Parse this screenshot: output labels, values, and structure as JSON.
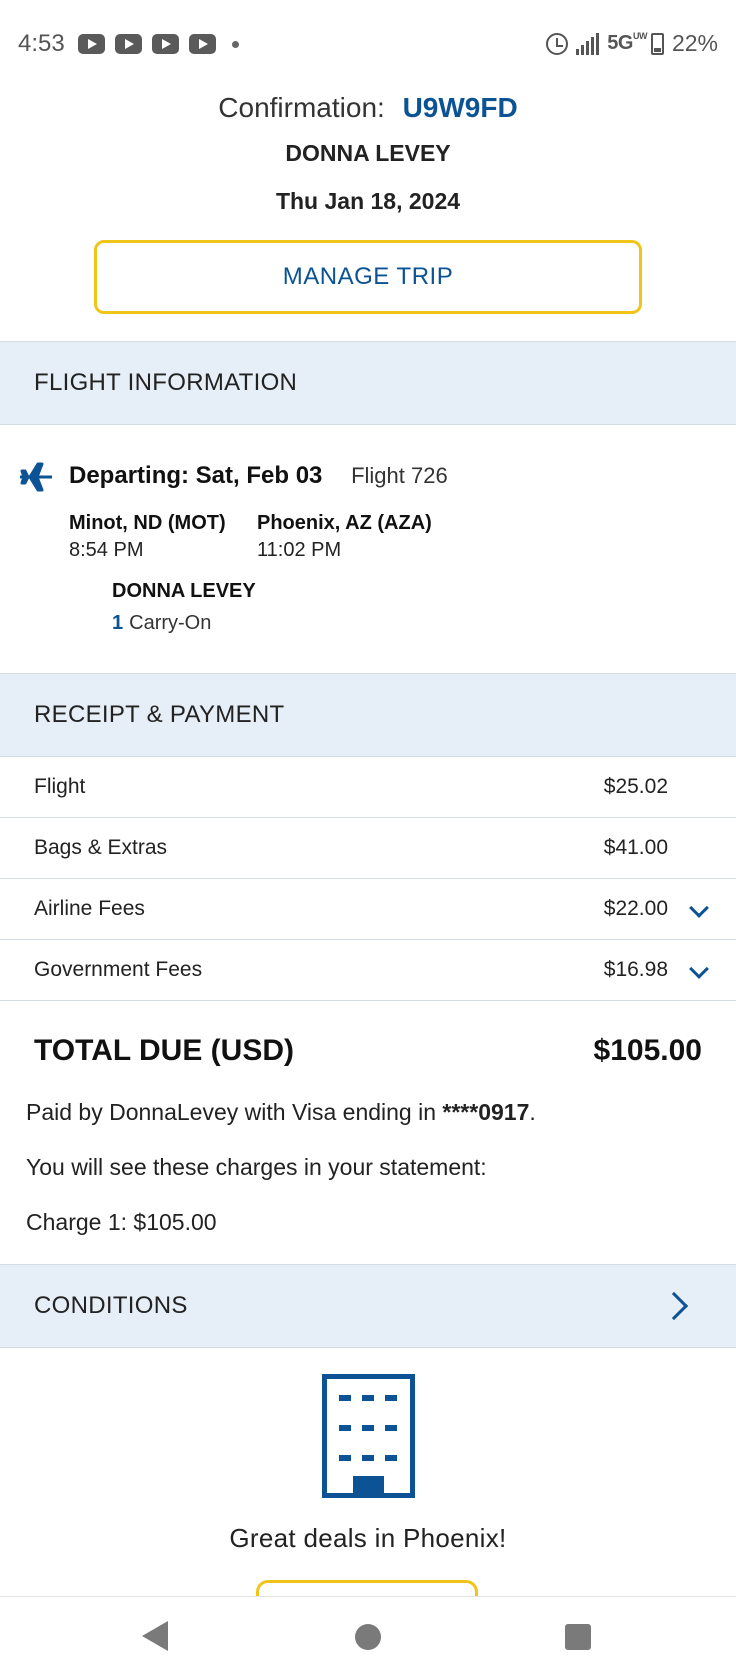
{
  "status_bar": {
    "time": "4:53",
    "network": "5G",
    "network_suffix": "UW",
    "battery": "22%"
  },
  "header": {
    "confirmation_label": "Confirmation:",
    "confirmation_code": "U9W9FD",
    "passenger_name": "DONNA LEVEY",
    "booking_date": "Thu Jan 18, 2024",
    "manage_trip_label": "MANAGE TRIP"
  },
  "flight_info": {
    "section_title": "FLIGHT INFORMATION",
    "departing": "Departing: Sat, Feb 03",
    "flight_number": "Flight 726",
    "origin": "Minot, ND (MOT)",
    "origin_time": "8:54 PM",
    "destination": "Phoenix, AZ (AZA)",
    "destination_time": "11:02 PM",
    "passenger": "DONNA LEVEY",
    "bag_count": "1",
    "bag_type": "Carry-On"
  },
  "receipt": {
    "section_title": "RECEIPT & PAYMENT",
    "rows": [
      {
        "label": "Flight",
        "amount": "$25.02"
      },
      {
        "label": "Bags & Extras",
        "amount": "$41.00"
      },
      {
        "label": "Airline Fees",
        "amount": "$22.00"
      },
      {
        "label": "Government Fees",
        "amount": "$16.98"
      }
    ],
    "total_label": "TOTAL DUE (USD)",
    "total_amount": "$105.00",
    "paid_by_prefix": "Paid by DonnaLevey with Visa ending in ",
    "card_mask": "****0917",
    "paid_by_suffix": ".",
    "statement_note": "You will see these charges in your statement:",
    "charge_1": "Charge 1: $105.00"
  },
  "conditions": {
    "section_title": "CONDITIONS"
  },
  "promo": {
    "text": "Great deals in Phoenix!"
  },
  "colors": {
    "brand_blue": "#0b5394",
    "accent_yellow": "#f0c419",
    "section_bg": "#e6eef7"
  }
}
